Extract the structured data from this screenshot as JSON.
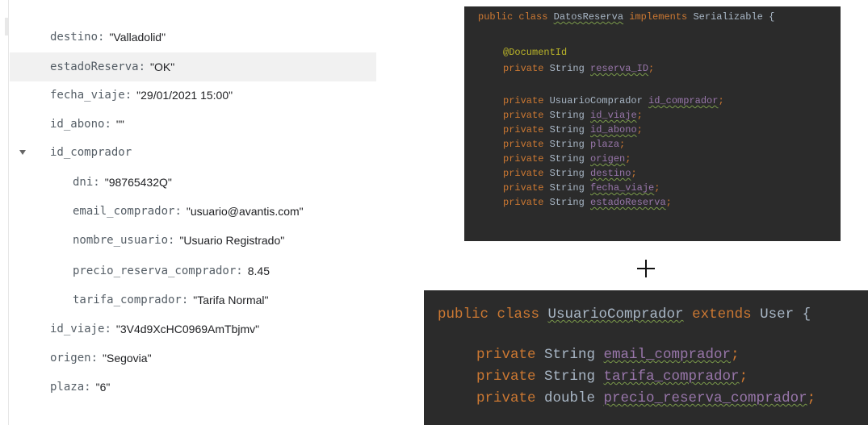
{
  "tree": {
    "fields": [
      {
        "key": "destino",
        "value": "\"Valladolid\""
      },
      {
        "key": "estadoReserva",
        "value": "\"OK\""
      },
      {
        "key": "fecha_viaje",
        "value": "\"29/01/2021 15:00\""
      },
      {
        "key": "id_abono",
        "value": "\"\""
      },
      {
        "key": "id_comprador",
        "value": ""
      },
      {
        "key": "dni",
        "value": "\"98765432Q\""
      },
      {
        "key": "email_comprador",
        "value": "\"usuario@avantis.com\""
      },
      {
        "key": "nombre_usuario",
        "value": "\"Usuario Registrado\""
      },
      {
        "key": "precio_reserva_comprador",
        "value": "8.45"
      },
      {
        "key": "tarifa_comprador",
        "value": "\"Tarifa Normal\""
      },
      {
        "key": "id_viaje",
        "value": "\"3V4d9XcHC0969AmTbjmv\""
      },
      {
        "key": "origen",
        "value": "\"Segovia\""
      },
      {
        "key": "plaza",
        "value": "\"6\""
      }
    ],
    "highlighted_field": "estadoReserva",
    "expand_icon": "caret-down-icon"
  },
  "code1": {
    "header": {
      "kw1": "public class ",
      "name": "DatosReserva",
      "kw2": " implements ",
      "iface": "Serializable {"
    },
    "annotation": "@DocumentId",
    "lines": [
      {
        "mod": "private ",
        "type": "String ",
        "name": "reserva_ID",
        "end": ";"
      },
      {
        "mod": "private ",
        "type": "UsuarioComprador ",
        "name": "id_comprador",
        "end": ";"
      },
      {
        "mod": "private ",
        "type": "String ",
        "name": "id_viaje",
        "end": ";"
      },
      {
        "mod": "private ",
        "type": "String ",
        "name": "id_abono",
        "end": ";"
      },
      {
        "mod": "private ",
        "type": "String ",
        "name": "plaza",
        "end": ";"
      },
      {
        "mod": "private ",
        "type": "String ",
        "name": "origen",
        "end": ";"
      },
      {
        "mod": "private ",
        "type": "String ",
        "name": "destino",
        "end": ";"
      },
      {
        "mod": "private ",
        "type": "String ",
        "name": "fecha_viaje",
        "end": ";"
      },
      {
        "mod": "private ",
        "type": "String ",
        "name": "estadoReserva",
        "end": ";"
      }
    ]
  },
  "plus_sign": "plus-icon",
  "code2": {
    "header": {
      "kw1": "public class ",
      "name": "UsuarioComprador",
      "kw2": " extends ",
      "parent": "User {"
    },
    "lines": [
      {
        "mod": "private ",
        "type": "String ",
        "name": "email_comprador",
        "end": ";"
      },
      {
        "mod": "private ",
        "type": "String ",
        "name": "tarifa_comprador",
        "end": ";"
      },
      {
        "mod": "private ",
        "type": "double ",
        "name": "precio_reserva_comprador",
        "end": ";"
      }
    ]
  },
  "colors": {
    "editor_bg": "#2b2b2b",
    "keyword": "#cc7832",
    "field": "#9876aa",
    "annotation": "#bbb529",
    "default_text": "#a9b7c6"
  }
}
